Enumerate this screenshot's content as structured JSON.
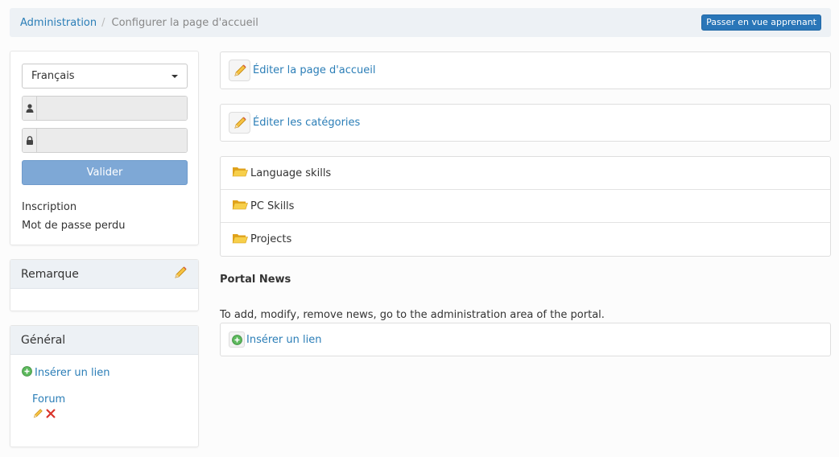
{
  "breadcrumb": {
    "items": [
      "Administration",
      "Configurer la page d'accueil"
    ],
    "separator": "/",
    "student_view_button": "Passer en vue apprenant"
  },
  "login": {
    "language": "Français",
    "username_value": "",
    "password_value": "",
    "submit_label": "Valider",
    "register_link": "Inscription",
    "lost_password_link": "Mot de passe perdu"
  },
  "remarque": {
    "title": "Remarque"
  },
  "general": {
    "title": "Général",
    "insert_link_label": "Insérer un lien",
    "links": [
      {
        "label": "Forum"
      }
    ]
  },
  "main": {
    "edit_homepage_label": "Éditer la page d'accueil",
    "edit_categories_label": "Éditer les catégories",
    "categories": [
      "Language skills",
      "PC Skills",
      "Projects"
    ],
    "portal_news_title": "Portal News",
    "portal_news_note": "To add, modify, remove news, go to the administration area of the portal.",
    "insert_link_label": "Insérer un lien"
  },
  "colors": {
    "link": "#2b7eb7",
    "primary_button": "#2a76b8",
    "validate_button": "#7ea8d6",
    "panel_heading": "#edf1f5"
  },
  "icons": {
    "edit": "pencil-icon",
    "folder": "folder-icon",
    "add": "plus-circle-icon",
    "delete": "delete-x-icon",
    "user": "user-icon",
    "lock": "lock-icon"
  }
}
